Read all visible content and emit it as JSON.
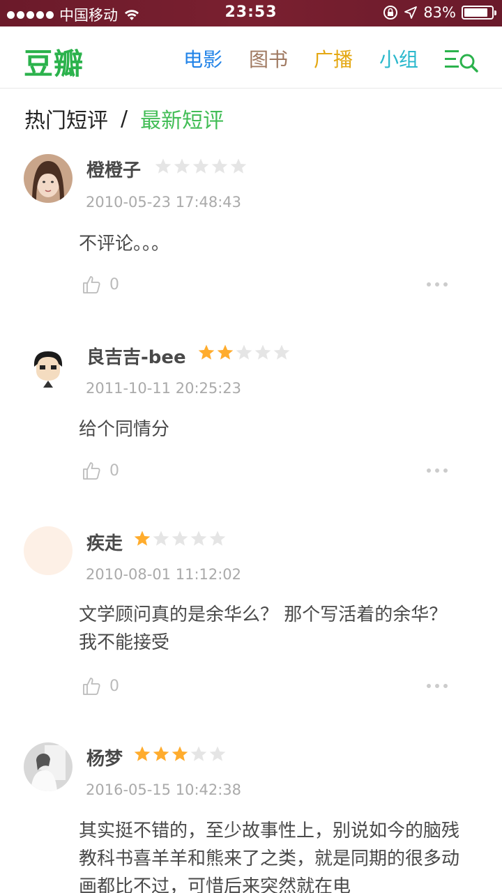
{
  "status_bar": {
    "carrier": "中国移动",
    "time": "23:53",
    "battery": "83%"
  },
  "nav": {
    "logo": "豆瓣",
    "links": [
      "电影",
      "图书",
      "广播",
      "小组"
    ]
  },
  "tabs": {
    "hot": "热门短评",
    "separator": "/",
    "latest": "最新短评"
  },
  "comments": [
    {
      "user": "橙橙子",
      "rating": 0,
      "time": "2010-05-23 17:48:43",
      "text": "不评论。。。",
      "likes": "0"
    },
    {
      "user": "良吉吉-bee",
      "rating": 2,
      "time": "2011-10-11 20:25:23",
      "text": "给个同情分",
      "likes": "0"
    },
    {
      "user": "疾走",
      "rating": 1,
      "time": "2010-08-01 11:12:02",
      "text": "文学顾问真的是余华么？ 那个写活着的余华？ 我不能接受",
      "likes": "0"
    },
    {
      "user": "杨梦",
      "rating": 3,
      "time": "2016-05-15 10:42:38",
      "text": "其实挺不错的，至少故事性上，别说如今的脑残教科书喜羊羊和熊来了之类，就是同期的很多动画都比不过，可惜后来突然就在电",
      "likes": "0"
    }
  ],
  "colors": {
    "brand_green": "#2bb24c",
    "star_on": "#ffac2d",
    "star_off": "#e5e5e5"
  }
}
